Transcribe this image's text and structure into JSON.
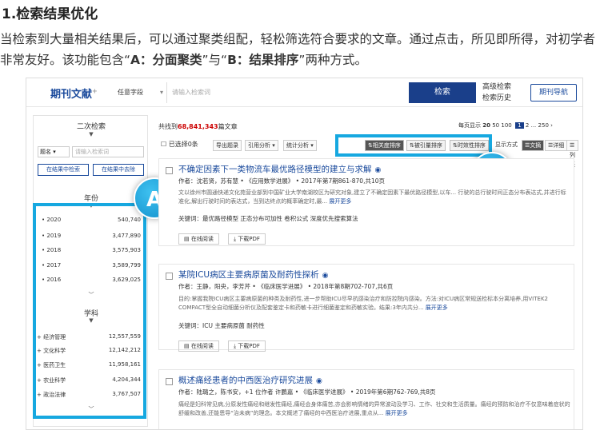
{
  "heading": "1.检索结果优化",
  "paragraph": {
    "part1": "当检索到大量相关结果后，可以通过聚类组配，轻松筛选符合要求的文章。通过点击，所见即所得，对初学者非常友好。该功能包含“",
    "bold1": "A：分面聚类",
    "part2": "”与“",
    "bold2": "B：结果排序",
    "part3": "”两种方式。"
  },
  "topbar": {
    "logo": "期刊文献",
    "field_select": "任意字段",
    "search_placeholder": "请输入检索词",
    "search_button": "检索",
    "advanced_search": "高级检索",
    "search_history": "检索历史",
    "nav_button": "期刊导航"
  },
  "left": {
    "secondary_title": "二次检索",
    "sel": "题名",
    "input_placeholder": "请输入检索词",
    "btn_in_results": "在结果中检索",
    "btn_exclude": "在结果中去除",
    "year_title": "年份",
    "years": [
      {
        "label": "2020",
        "count": "540,740"
      },
      {
        "label": "2019",
        "count": "3,477,890"
      },
      {
        "label": "2018",
        "count": "3,575,903"
      },
      {
        "label": "2017",
        "count": "3,589,799"
      },
      {
        "label": "2016",
        "count": "3,629,025"
      }
    ],
    "subject_title": "学科",
    "subjects": [
      {
        "label": "经济管理",
        "count": "12,557,559"
      },
      {
        "label": "文化科学",
        "count": "12,142,212"
      },
      {
        "label": "医药卫生",
        "count": "11,958,161"
      },
      {
        "label": "农业科学",
        "count": "4,204,344"
      },
      {
        "label": "政治法律",
        "count": "3,767,507"
      }
    ]
  },
  "results": {
    "found_prefix": "共找到",
    "found_count": "68,841,343",
    "found_suffix": "篇文章",
    "per_page": "每页显示",
    "per_page_options": [
      "20",
      "50",
      "100"
    ],
    "pages": [
      "1",
      "2",
      "...",
      "250",
      "›"
    ],
    "toolbar": {
      "selected": "已选择0条",
      "export": "导出题录",
      "citation": "引用分析 ▾",
      "stats": "统计分析 ▾",
      "sort_relevance": "相关度排序",
      "sort_cited": "被引量排序",
      "sort_time": "时效性排序",
      "display_mode": "显示方式",
      "view_abstract": "文摘",
      "view_detail": "详细",
      "view_list": "列表"
    },
    "articles": [
      {
        "title": "不确定因素下一类物流车最优路径模型的建立与求解",
        "authors": "作者：沈若贤，苏有慧 • 《应用数学进展》 • 2017年第7期861-870,共10页",
        "abstract": "文以徐州市圆通快递文化苑营业部到中国矿业大学南湖校区为研究对象,建立了不确定因素下最优路径模型,以车... 行驶的总行驶时间正态分布表达式,并进行标准化,解出行驶时间的表达式，当到达终点的概率确定时,最...",
        "more": "展开更多",
        "keywords": "关键词：最优路径模型  正态分布可加性  卷积公式  深度优先搜索算法",
        "read": "在线阅读",
        "download": "下载PDF"
      },
      {
        "title": "某院ICU病区主要病原菌及耐药性探析",
        "authors": "作者：王静，阳央，李芳芹 • 《临床医学进展》 • 2018年第8期702-707,共6页",
        "abstract": "目的:掌握我院ICU病区主要病原菌的种类及耐药性,进一步帮助ICU尽早抗感染治疗和防控院内感染。方法:对ICU病区常规送检标本分离培养,用VITEK2 COMPACT型全自动细菌分析仪及配套鉴定卡和药敏卡进行细菌鉴定和药敏实验。结果:3年内共分...",
        "more": "展开更多",
        "keywords": "关键词：ICU  主要病原菌  耐药性",
        "read": "在线阅读",
        "download": "下载PDF"
      },
      {
        "title": "概述痛经患者的中西医治疗研究进展",
        "authors": "作者：陆璐之，陈书安，+1 位作者  许鹏嘉 • 《临床医学进展》 • 2019年第6期762-769,共8页",
        "abstract": "痛经是妇科常见病,分原发性痛经和继发性痛经,痛经会身体痛苦,亦会影响情绪的异常波动及学习、工作、社交和生活质量。痛经的预防和治疗不仅意味着症状的舒缓和改善,还能恩导“治未病”的理念。本文概述了痛经的中西医治疗进展,重点从...",
        "more": "展开更多"
      }
    ]
  },
  "badges": {
    "a": "A",
    "b": "B"
  },
  "colors": {
    "highlight": "#16a8e0",
    "brand": "#1a3f8a",
    "count_red": "#cc0000"
  }
}
